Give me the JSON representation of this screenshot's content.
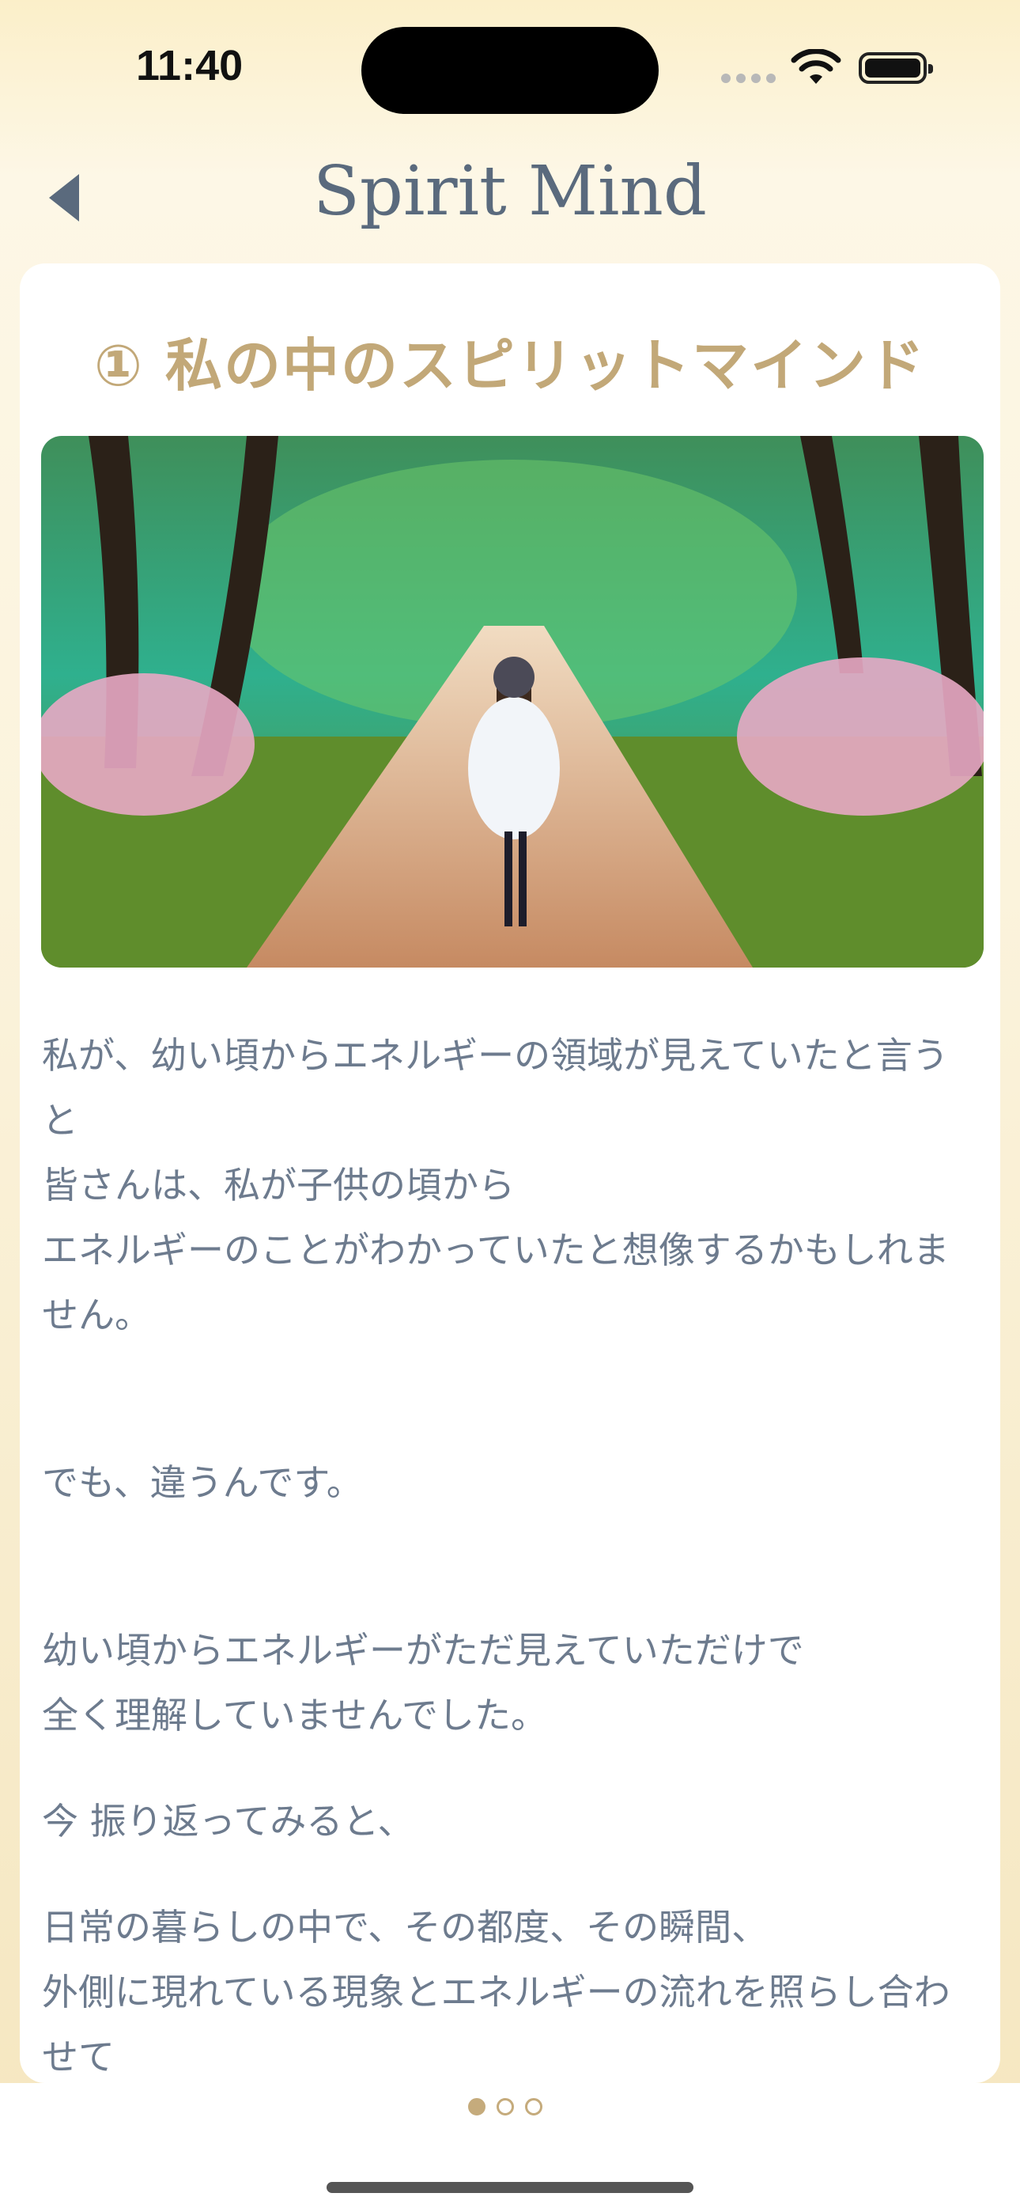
{
  "status_bar": {
    "time": "11:40"
  },
  "nav": {
    "title": "Spirit Mind"
  },
  "article": {
    "title": "① 私の中のスピリットマインド",
    "paragraphs": [
      "私が、幼い頃からエネルギーの領域が見えていたと言うと",
      "皆さんは、私が子供の頃から",
      "エネルギーのことがわかっていたと想像するかもしれません。",
      "でも、違うんです。",
      "幼い頃からエネルギーがただ見えていただけで",
      "全く理解していませんでした。",
      "今 振り返ってみると、",
      "日常の暮らしの中で、その都度、その瞬間、",
      "外側に現れている現象とエネルギーの流れを照らし合わせて"
    ]
  },
  "pager": {
    "pages": 3,
    "current": 1
  },
  "colors": {
    "accent": "#c2a878",
    "text": "#6d7b8e",
    "nav_title": "#5a6a7d"
  },
  "icons": {
    "back": "chevron-left-icon",
    "wifi": "wifi-icon",
    "battery": "battery-icon"
  }
}
